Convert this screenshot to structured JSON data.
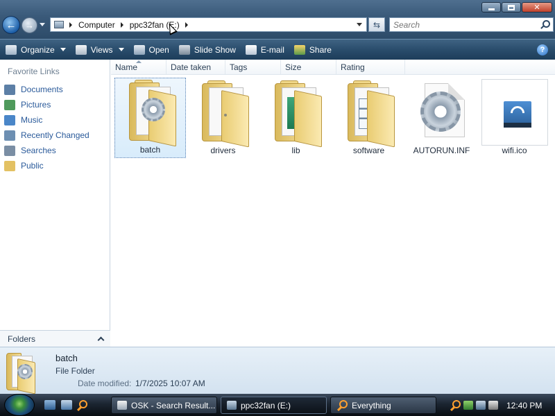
{
  "window": {
    "breadcrumb": [
      "Computer",
      "ppc32fan (E:)"
    ],
    "search_placeholder": "Search",
    "caption_buttons": {
      "minimize": "minimize-icon",
      "maximize": "maximize-icon",
      "close": "close-icon"
    }
  },
  "toolbar": {
    "organize": "Organize",
    "views": "Views",
    "open": "Open",
    "slideshow": "Slide Show",
    "email": "E-mail",
    "share": "Share",
    "help": "?"
  },
  "navpane": {
    "heading": "Favorite Links",
    "links": [
      {
        "label": "Documents",
        "icon": "documents-icon",
        "color": "#5c7fa6"
      },
      {
        "label": "Pictures",
        "icon": "pictures-icon",
        "color": "#4f9a5c"
      },
      {
        "label": "Music",
        "icon": "music-icon",
        "color": "#4a86c8"
      },
      {
        "label": "Recently Changed",
        "icon": "recent-icon",
        "color": "#6d8fb2"
      },
      {
        "label": "Searches",
        "icon": "searches-icon",
        "color": "#7a8ea4"
      },
      {
        "label": "Public",
        "icon": "public-folder-icon",
        "color": "#e3c163"
      }
    ],
    "folders_label": "Folders"
  },
  "columns": [
    "Name",
    "Date taken",
    "Tags",
    "Size",
    "Rating"
  ],
  "items": [
    {
      "label": "batch",
      "type": "folder",
      "selected": true
    },
    {
      "label": "drivers",
      "type": "folder"
    },
    {
      "label": "lib",
      "type": "folder"
    },
    {
      "label": "software",
      "type": "folder"
    },
    {
      "label": "AUTORUN.INF",
      "type": "settings-file"
    },
    {
      "label": "wifi.ico",
      "type": "icon-file"
    }
  ],
  "details": {
    "name": "batch",
    "type": "File Folder",
    "modified_label": "Date modified:",
    "modified_value": "1/7/2025 10:07 AM"
  },
  "taskbar": {
    "tasks": [
      {
        "label": "OSK - Search Result...",
        "active": false
      },
      {
        "label": "ppc32fan (E:)",
        "active": true
      },
      {
        "label": "Everything",
        "active": false
      }
    ],
    "clock": "12:40 PM"
  },
  "colors": {
    "titlebar": "#3a5a7a",
    "selection": "#d8ecfb",
    "link": "#2a5a9a"
  }
}
